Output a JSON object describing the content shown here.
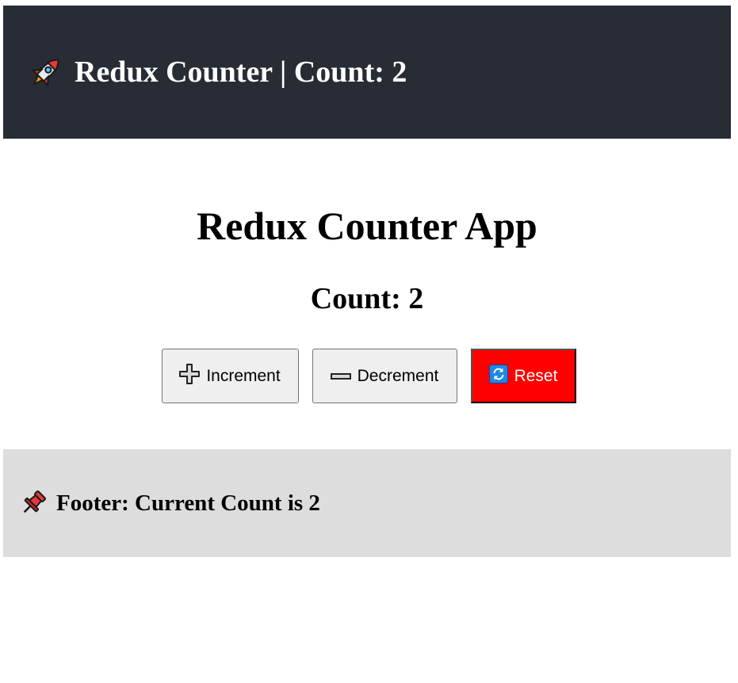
{
  "header": {
    "icon": "rocket-icon",
    "title": "Redux Counter | Count: 2"
  },
  "main": {
    "title": "Redux Counter App",
    "count_label": "Count: 2",
    "buttons": {
      "increment": {
        "icon": "plus-icon",
        "label": "Increment"
      },
      "decrement": {
        "icon": "minus-icon",
        "label": "Decrement"
      },
      "reset": {
        "icon": "refresh-icon",
        "label": "Reset"
      }
    }
  },
  "footer": {
    "icon": "pushpin-icon",
    "text": "Footer: Current Count is 2"
  },
  "colors": {
    "header_bg": "#282c34",
    "footer_bg": "#dddddd",
    "reset_bg": "#ff0000",
    "reset_text": "#ffffff"
  }
}
